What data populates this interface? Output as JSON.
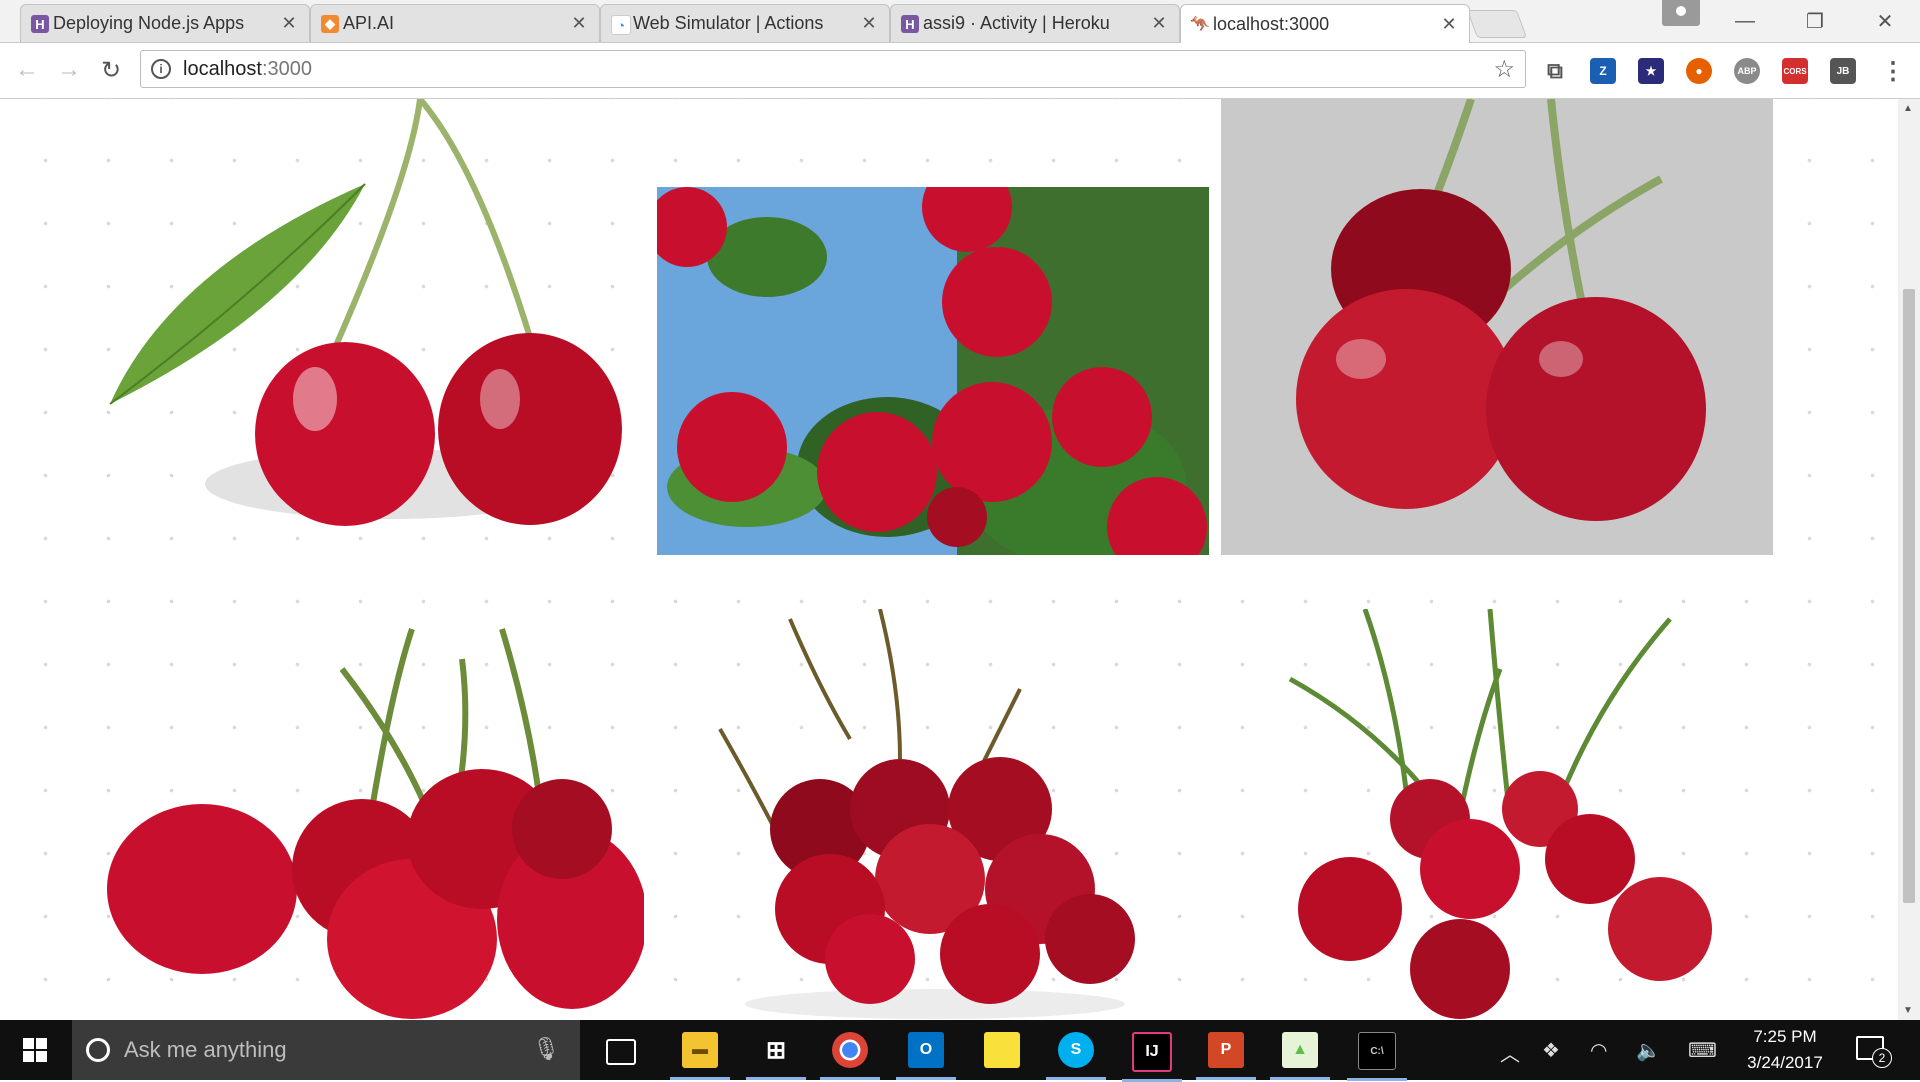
{
  "browser": {
    "tabs": [
      {
        "title": "Deploying Node.js Apps",
        "favicon": "heroku-icon",
        "favicon_color": "#79589f"
      },
      {
        "title": "API.AI",
        "favicon": "api-ai-icon",
        "favicon_color": "#f28b30"
      },
      {
        "title": "Web Simulator  |  Actions",
        "favicon": "google-actions-icon",
        "favicon_color": "#4285f4"
      },
      {
        "title": "assi9 · Activity | Heroku",
        "favicon": "heroku-icon",
        "favicon_color": "#79589f"
      },
      {
        "title": "localhost:3000",
        "favicon": "kangaroo-icon",
        "favicon_color": "#d4a017",
        "active": true
      }
    ],
    "close_glyph": "✕",
    "address": {
      "host": "localhost",
      "port": ":3000"
    },
    "extensions": [
      {
        "name": "cast-icon",
        "label": "⬚",
        "color": "#555555"
      },
      {
        "name": "zotero-icon",
        "label": "Z",
        "color": "#1a5fb4"
      },
      {
        "name": "astronomy-icon",
        "label": "★",
        "color": "#2b2b7a"
      },
      {
        "name": "firefox-like-icon",
        "label": "●",
        "color": "#e66000"
      },
      {
        "name": "adblock-plus-icon",
        "label": "ABP",
        "color": "#8a8a8a"
      },
      {
        "name": "cors-icon",
        "label": "CORS",
        "color": "#d32f2f"
      },
      {
        "name": "jetbrains-icon",
        "label": "JB",
        "color": "#555555"
      }
    ],
    "menu_glyph": "⋮"
  },
  "page": {
    "images": [
      {
        "name": "cherry-pair-with-leaf-photo",
        "background": "#ffffff"
      },
      {
        "name": "cherries-on-tree-photo",
        "background": "#5d98d4"
      },
      {
        "name": "cherry-trio-gray-photo",
        "background": "#c9c9c9"
      },
      {
        "name": "cherry-cluster-photo",
        "background": "#ffffff"
      },
      {
        "name": "cherry-pile-photo",
        "background": "#ffffff"
      },
      {
        "name": "cherry-bunch-stems-photo",
        "background": "#ffffff"
      }
    ]
  },
  "taskbar": {
    "search_placeholder": "Ask me anything",
    "apps": [
      {
        "name": "task-view-icon",
        "label": "▭",
        "color": "#ffffff"
      },
      {
        "name": "file-explorer-icon",
        "label": "▬",
        "color": "#f4c430"
      },
      {
        "name": "store-icon",
        "label": "⊞",
        "color": "#ffffff"
      },
      {
        "name": "chrome-icon",
        "label": "◉",
        "color": "#4caf50"
      },
      {
        "name": "outlook-icon",
        "label": "O",
        "color": "#0072c6"
      },
      {
        "name": "sticky-notes-icon",
        "label": "▰",
        "color": "#f9e03b"
      },
      {
        "name": "skype-icon",
        "label": "S",
        "color": "#00aff0"
      },
      {
        "name": "intellij-icon",
        "label": "IJ",
        "color": "#e23b7d"
      },
      {
        "name": "powerpoint-icon",
        "label": "P",
        "color": "#d24726"
      },
      {
        "name": "image-viewer-icon",
        "label": "▲",
        "color": "#5bbf4a"
      },
      {
        "name": "cmd-icon",
        "label": "C:\\",
        "color": "#cccccc"
      }
    ],
    "time": "7:25 PM",
    "date": "3/24/2017",
    "notification_count": "2"
  }
}
